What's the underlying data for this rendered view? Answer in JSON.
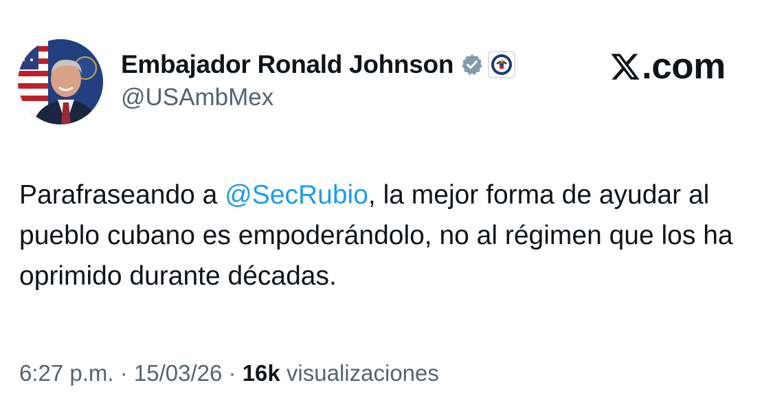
{
  "author": {
    "display_name": "Embajador Ronald Johnson",
    "handle": "@USAmbMex",
    "avatar_icon": "profile-photo",
    "verified_icon": "verified-badge-gray-icon",
    "affiliation_icon": "us-department-of-state-seal-icon"
  },
  "brand": {
    "label": ".com",
    "glyph": "X"
  },
  "tweet": {
    "text_before": "Parafraseando a ",
    "mention": "@SecRubio",
    "text_after": ", la mejor forma de ayudar al pueblo cubano es empoderándolo, no al régimen que los ha oprimido durante décadas."
  },
  "meta": {
    "time": "6:27 p.m.",
    "sep1": " · ",
    "date": "15/03/26",
    "sep2": " · ",
    "views_count": "16k",
    "views_label": " visualizaciones"
  },
  "colors": {
    "text": "#0f1419",
    "secondary": "#536471",
    "link": "#1d9bf0",
    "verified_gray": "#829aab"
  }
}
